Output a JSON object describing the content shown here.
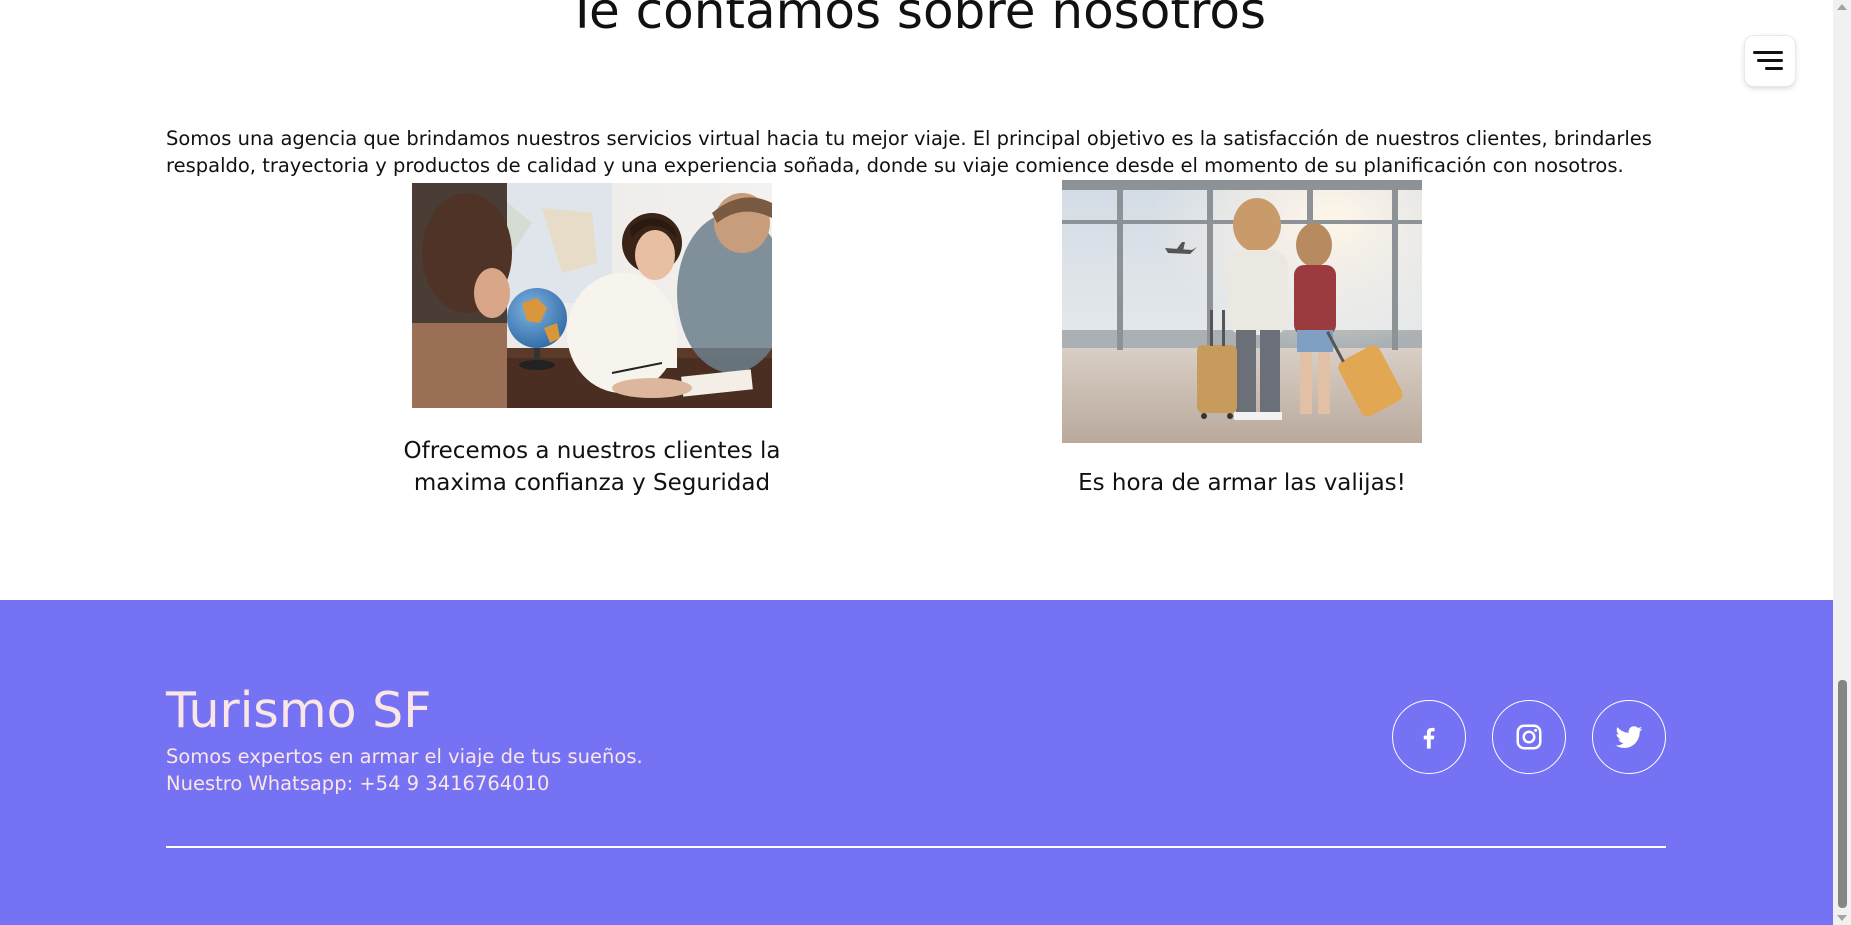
{
  "about": {
    "title": "Te contamos sobre nosotros",
    "intro": "Somos una agencia que brindamos nuestros servicios virtual hacia tu mejor viaje. El principal objetivo es la satisfacción de nuestros clientes, brindarles respaldo, trayectoria y productos de calidad y una experiencia soñada, donde su viaje comience desde el momento de su planificación con nosotros.",
    "cards": [
      {
        "caption": "Ofrecemos a nuestros clientes la maxima confianza y Seguridad"
      },
      {
        "caption": "Es hora de armar las valijas!"
      }
    ]
  },
  "menu": {
    "icon": "hamburger-menu-icon"
  },
  "footer": {
    "brand": "Turismo SF",
    "tagline": "Somos expertos en armar el viaje de tus sueños.",
    "whatsapp": "Nuestro Whatsapp: +54 9 3416764010",
    "social": [
      {
        "name": "facebook",
        "icon": "facebook-icon"
      },
      {
        "name": "instagram",
        "icon": "instagram-icon"
      },
      {
        "name": "twitter",
        "icon": "twitter-icon"
      }
    ],
    "background_color": "#7672f4",
    "text_color": "#fbe6e6"
  }
}
